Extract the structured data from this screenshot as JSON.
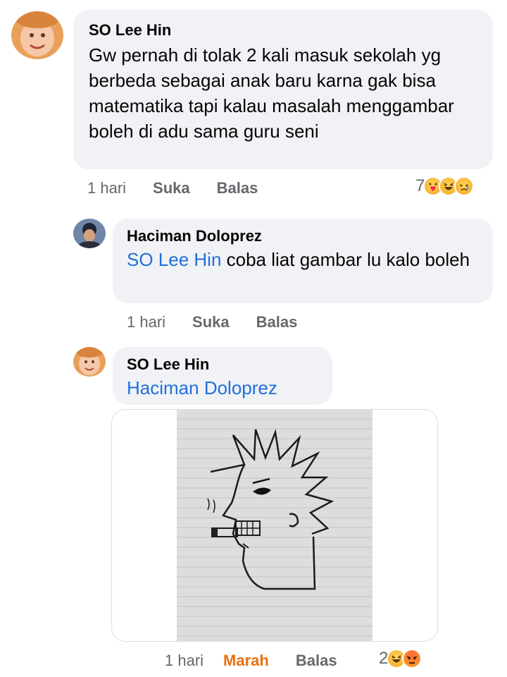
{
  "comments": [
    {
      "author": "SO Lee Hin",
      "text": "Gw pernah di tolak 2 kali masuk sekolah yg berbeda sebagai anak baru karna gak bisa matematika tapi kalau masalah menggambar boleh di adu sama guru seni",
      "time": "1 hari",
      "like": "Suka",
      "reply": "Balas",
      "reaction_count": "7",
      "reactions": [
        "care-emoji",
        "haha-emoji",
        "sad-emoji"
      ]
    },
    {
      "author": "Haciman Doloprez",
      "mention": "SO Lee Hin",
      "text": "coba liat gambar lu kalo boleh",
      "time": "1 hari",
      "like": "Suka",
      "reply": "Balas"
    },
    {
      "author": "SO Lee Hin",
      "mention": "Haciman Doloprez",
      "time": "1 hari",
      "like": "Marah",
      "reply": "Balas",
      "reaction_count": "2",
      "reactions": [
        "haha-emoji",
        "angry-emoji"
      ]
    }
  ],
  "colors": {
    "bubble": "#f0f2f5",
    "mention": "#216fdb",
    "meta": "#65676b",
    "angry": "#e9710f"
  }
}
